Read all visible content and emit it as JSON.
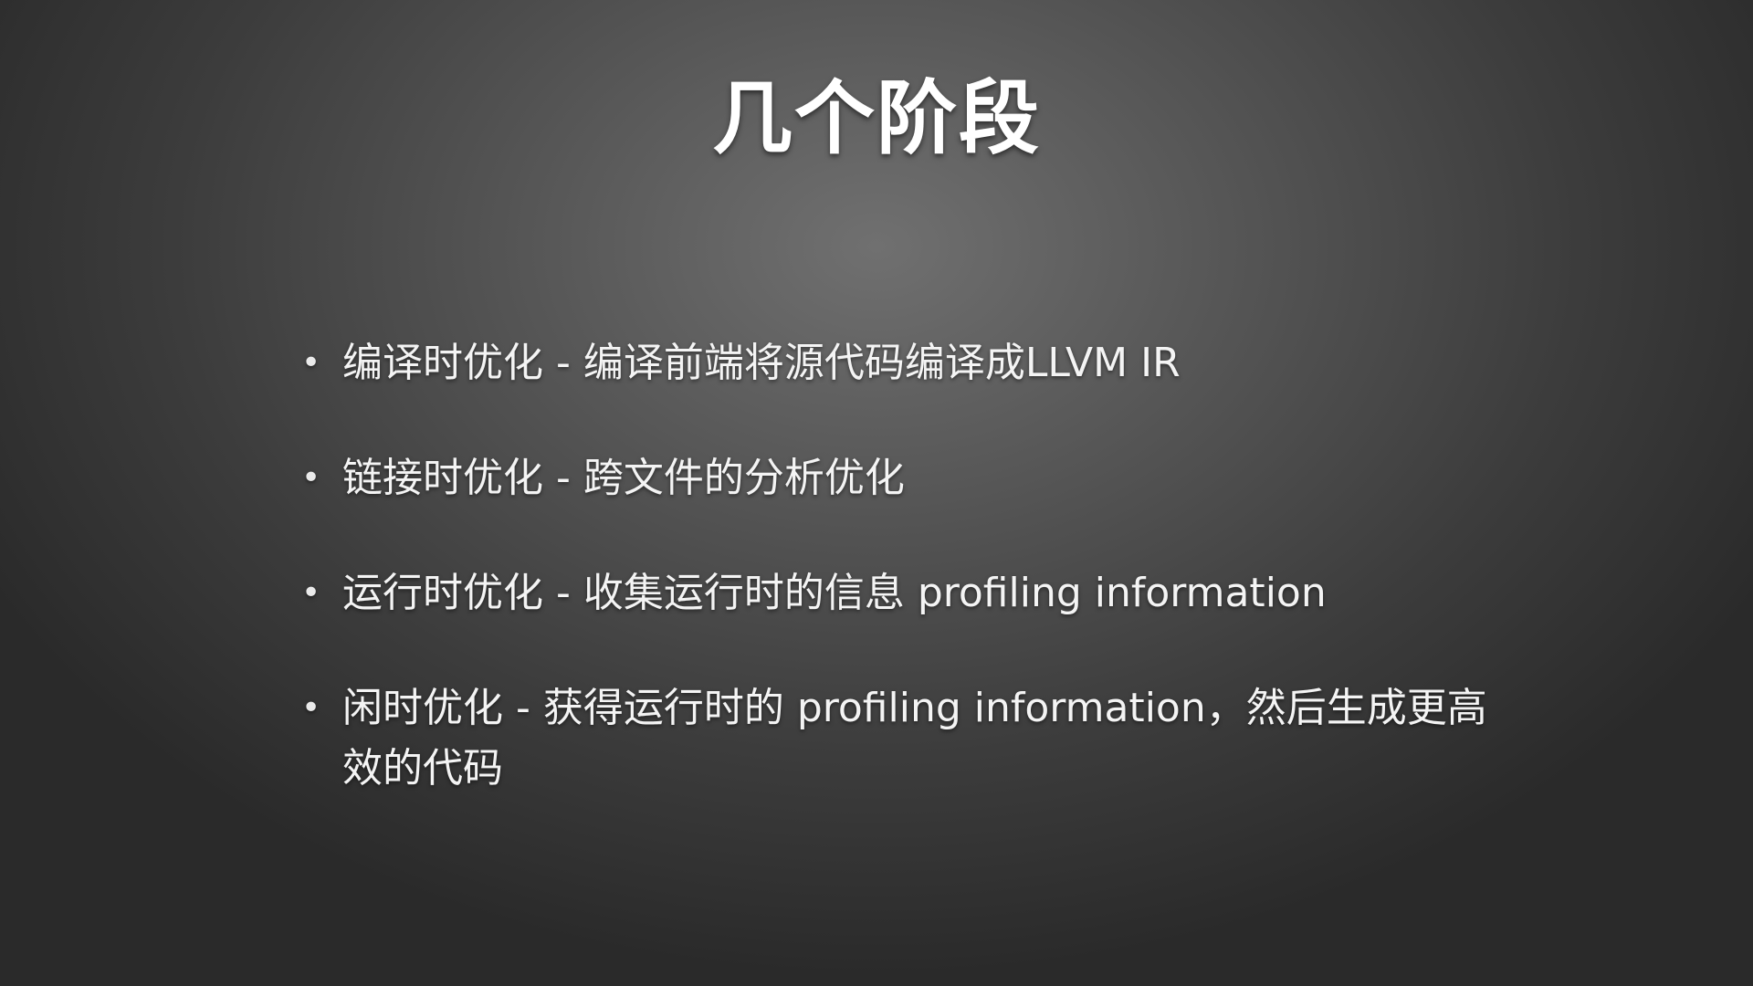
{
  "slide": {
    "title": "几个阶段",
    "bullets": [
      {
        "marker": "•",
        "text": "编译时优化 - 编译前端将源代码编译成LLVM IR"
      },
      {
        "marker": "•",
        "text": "链接时优化 - 跨文件的分析优化"
      },
      {
        "marker": "•",
        "text": "运行时优化 - 收集运行时的信息 profiling information"
      },
      {
        "marker": "•",
        "text": "闲时优化 - 获得运行时的 profiling information，然后生成更高效的代码"
      }
    ]
  }
}
